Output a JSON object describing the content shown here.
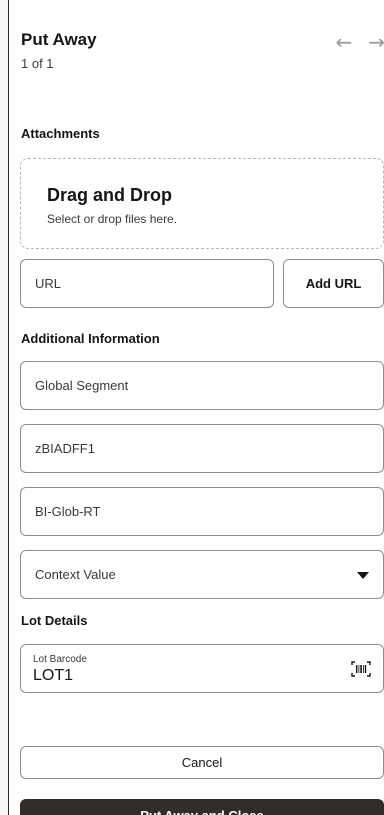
{
  "header": {
    "title": "Put Away",
    "subtitle": "1 of 1",
    "prev_icon": "arrow-left-icon",
    "next_icon": "arrow-right-icon"
  },
  "attachments": {
    "label": "Attachments",
    "dropzone_title": "Drag and Drop",
    "dropzone_subtitle": "Select or drop files here.",
    "url_placeholder": "URL",
    "add_url_label": "Add URL"
  },
  "additional_info": {
    "label": "Additional Information",
    "fields": [
      "Global Segment",
      "zBIADFF1",
      "BI-Glob-RT"
    ],
    "context_select": "Context Value"
  },
  "lot_details": {
    "label": "Lot Details",
    "barcode_label": "Lot Barcode",
    "barcode_value": "LOT1",
    "scan_icon": "barcode-scan-icon"
  },
  "footer": {
    "cancel_label": "Cancel",
    "primary_label": "Put Away and Close"
  },
  "colors": {
    "primary_button_bg": "#312d2a",
    "border": "#8f8c88",
    "text": "#161513"
  }
}
